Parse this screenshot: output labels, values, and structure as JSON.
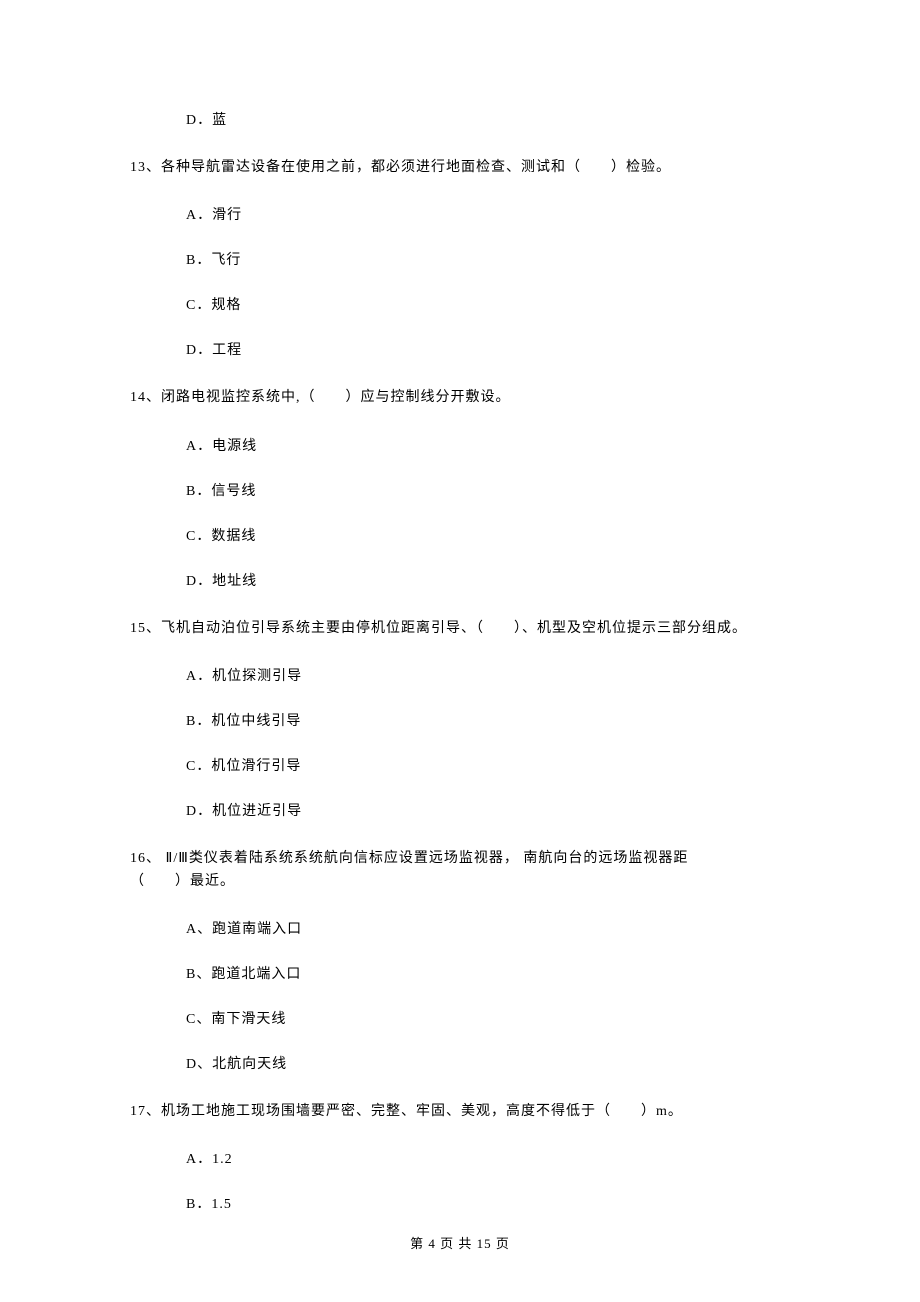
{
  "q12": {
    "optD": "D．蓝"
  },
  "q13": {
    "stem": "13、各种导航雷达设备在使用之前，都必须进行地面检查、测试和（　　）检验。",
    "optA": "A．滑行",
    "optB": "B．飞行",
    "optC": "C．规格",
    "optD": "D．工程"
  },
  "q14": {
    "stem": "14、闭路电视监控系统中,（　　）应与控制线分开敷设。",
    "optA": "A．电源线",
    "optB": "B．信号线",
    "optC": "C．数据线",
    "optD": "D．地址线"
  },
  "q15": {
    "stem": "15、飞机自动泊位引导系统主要由停机位距离引导、（　　）、机型及空机位提示三部分组成。",
    "optA": "A．机位探测引导",
    "optB": "B．机位中线引导",
    "optC": "C．机位滑行引导",
    "optD": "D．机位进近引导"
  },
  "q16": {
    "stem1": "16、 Ⅱ/Ⅲ类仪表着陆系统系统航向信标应设置远场监视器，  南航向台的远场监视器距",
    "stem2": "（　　）最近。",
    "optA": "A、跑道南端入口",
    "optB": "B、跑道北端入口",
    "optC": "C、南下滑天线",
    "optD": "D、北航向天线"
  },
  "q17": {
    "stem": "17、机场工地施工现场围墙要严密、完整、牢固、美观，高度不得低于（　　）m。",
    "optA": "A．1.2",
    "optB": "B．1.5"
  },
  "footer": "第 4 页 共 15 页"
}
